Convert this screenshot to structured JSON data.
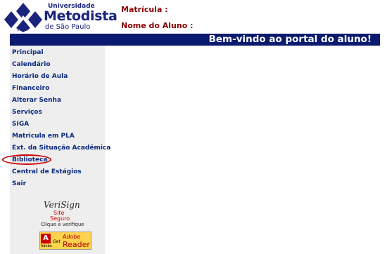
{
  "header": {
    "logo": {
      "line1": "Universidade",
      "line2": "Metodista",
      "line3": "de São Paulo",
      "mark_text": "UMESP"
    },
    "matricula_label": "Matrícula :",
    "nome_label": "Nome do Aluno :"
  },
  "banner": {
    "text": "Bem-vindo ao portal do aluno!"
  },
  "sidebar": {
    "items": [
      {
        "label": "Principal"
      },
      {
        "label": "Calendário"
      },
      {
        "label": "Horário de Aula"
      },
      {
        "label": "Financeiro"
      },
      {
        "label": "Alterar Senha"
      },
      {
        "label": "Serviços"
      },
      {
        "label": "SIGA"
      },
      {
        "label": "Matricula em PLA"
      },
      {
        "label": "Ext. da Situação Acadêmica"
      },
      {
        "label": "Biblioteca"
      },
      {
        "label": "Central de Estágios"
      },
      {
        "label": "Sair"
      }
    ],
    "highlighted_item": "Biblioteca"
  },
  "badges": {
    "verisign": {
      "name": "VeriSign",
      "line1": "Site",
      "line2": "Seguro",
      "caption": "Clique e verifique"
    },
    "adobe": {
      "vendor": "Adobe",
      "get": "Get",
      "brand": "Adobe",
      "product": "Reader"
    }
  },
  "colors": {
    "banner_bg": "#0a1a6e",
    "menu_text": "#0a2a80",
    "field_label": "#8b0000",
    "highlight": "#cc0000"
  }
}
